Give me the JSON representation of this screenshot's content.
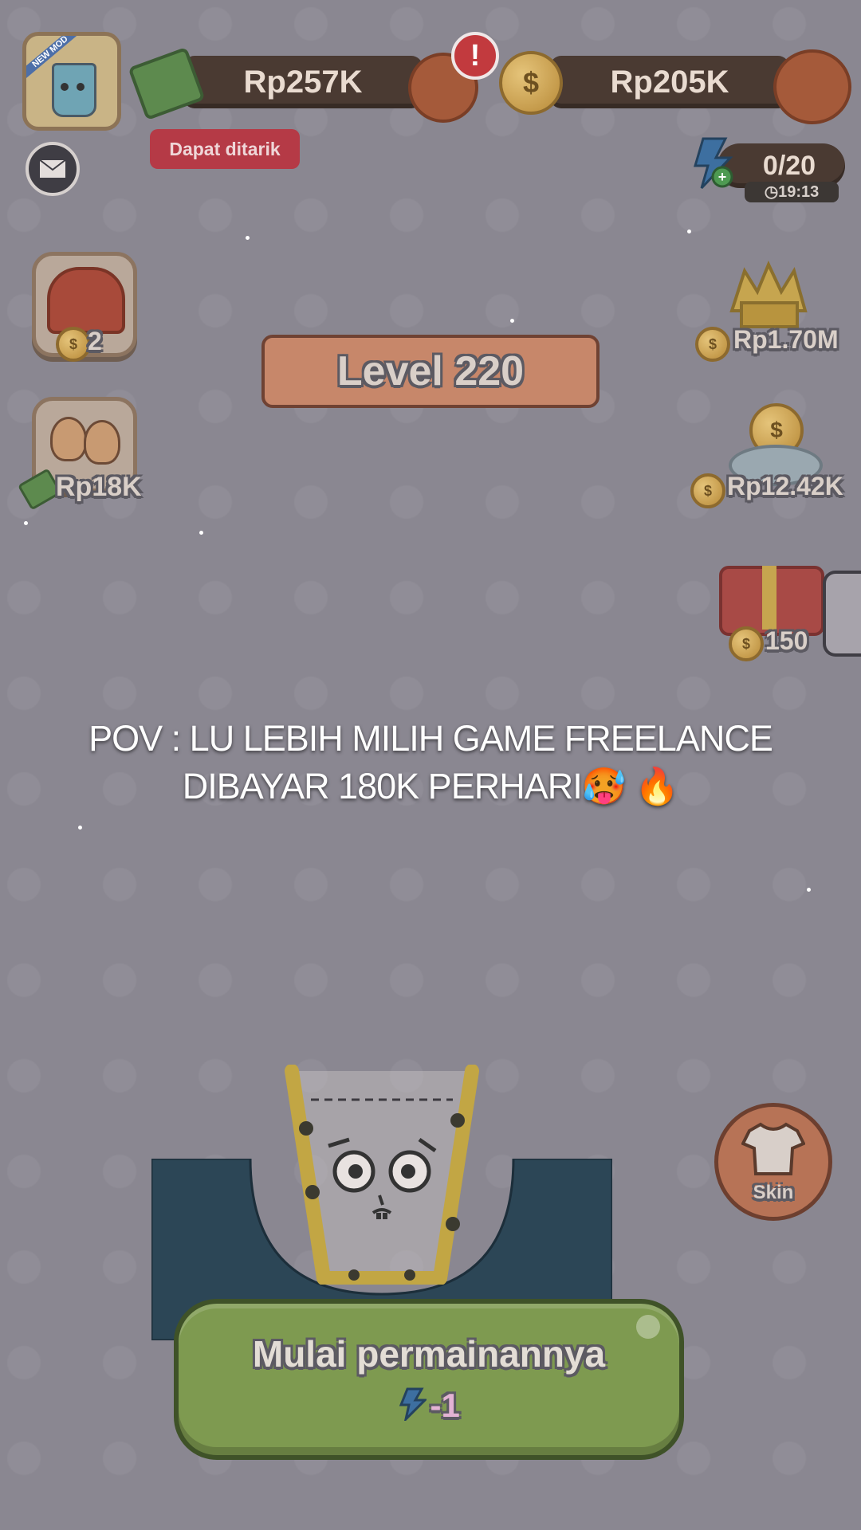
{
  "topbar": {
    "cash_balance": "Rp257K",
    "coin_balance": "Rp205K",
    "withdraw_badge": "Dapat ditarik",
    "app_icon_badge": "NEW MOD",
    "alert_mark": "!"
  },
  "energy": {
    "count": "0/20",
    "timer": "19:13"
  },
  "level": {
    "label": "Level 220"
  },
  "left_side": {
    "chest_count": "2",
    "friends_reward": "Rp18K"
  },
  "right_side": {
    "ranking_reward": "Rp1.70M",
    "fountain_reward": "Rp12.42K",
    "gift_count": "150"
  },
  "caption": {
    "line1": "POV : LU LEBIH MILIH GAME FREELANCE",
    "line2": "DIBAYAR 180K PERHARI",
    "emoji": "🥵 🔥"
  },
  "skin_button": {
    "label": "Skin"
  },
  "start_button": {
    "label": "Mulai permainannya",
    "cost": "-1"
  },
  "colors": {
    "overlay": "#8a8791",
    "pill": "#4a3a32",
    "start_green": "#7e9a50",
    "badge_red": "#c2404a",
    "container": "#2c4656"
  }
}
